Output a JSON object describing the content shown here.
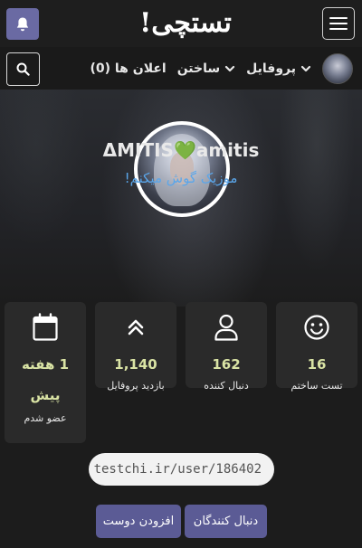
{
  "header": {
    "logo_text": "تستچی!",
    "bell_icon": "bell-icon",
    "menu_icon": "hamburger-menu-icon"
  },
  "nav": {
    "search_icon": "search-icon",
    "profile_label": "پروفایل",
    "build_label": "ساختن",
    "notifications_label": "اعلان ها (0)"
  },
  "profile": {
    "username_part1": "ΔMITIS",
    "heart": "💚",
    "username_part2": "amitis",
    "bio": "موزیک گوش میکنم!"
  },
  "stats": [
    {
      "icon": "smiley-icon",
      "value": "16",
      "label": "تست ساختم"
    },
    {
      "icon": "user-icon",
      "value": "162",
      "label": "دنبال کننده"
    },
    {
      "icon": "double-chevron-up-icon",
      "value": "1,140",
      "label": "بازدید پروفایل"
    },
    {
      "icon": "calendar-icon",
      "value_line1": "1 هفته",
      "value_line2": "پیش",
      "label": "عضو شدم"
    }
  ],
  "profile_url": "testchi.ir/user/186402",
  "buttons": {
    "followers": "دنبال کنندگان",
    "add_friend": "افزودن دوست"
  },
  "colors": {
    "accent_purple": "#5b5b95",
    "bell_purple": "#6a6aa3",
    "stat_value": "#d9e3a4",
    "bio_blue": "#5aa6ea",
    "heart_green": "#4fd14f"
  }
}
